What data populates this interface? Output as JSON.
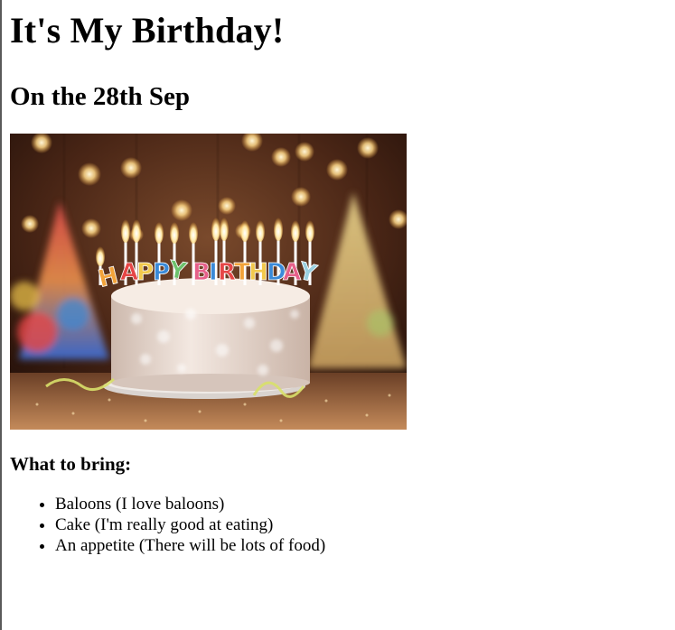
{
  "page": {
    "title": "It's My Birthday!",
    "subtitle": "On the 28th Sep",
    "image_alt": "Birthday cake with Happy Birthday candles",
    "bring_heading": "What to bring:",
    "bring_items": [
      "Baloons (I love baloons)",
      "Cake (I'm really good at eating)",
      "An appetite (There will be lots of food)"
    ]
  },
  "colors": {
    "background": "#ffffff",
    "text": "#000000",
    "border": "#5a5a5a"
  }
}
